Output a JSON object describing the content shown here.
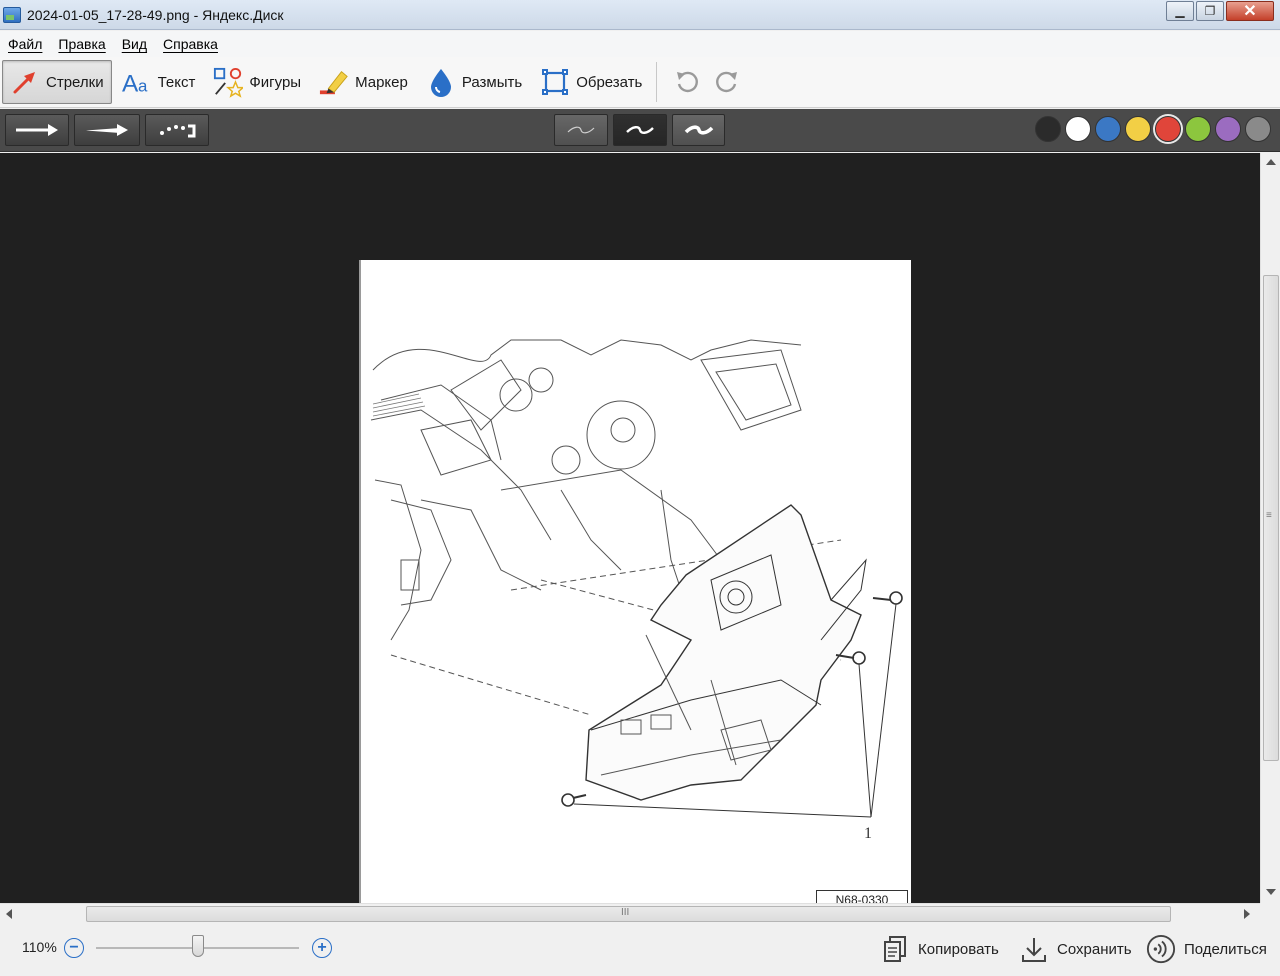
{
  "window": {
    "title": "2024-01-05_17-28-49.png - Яндекс.Диск",
    "minimize_glyph": "▁",
    "maximize_glyph": "❐",
    "close_glyph": "✕"
  },
  "menu": [
    {
      "label": "Файл"
    },
    {
      "label": "Правка"
    },
    {
      "label": "Вид"
    },
    {
      "label": "Справка"
    }
  ],
  "toolbar": {
    "tools": [
      {
        "label": "Стрелки",
        "icon": "arrow-tool-icon",
        "active": true
      },
      {
        "label": "Текст",
        "icon": "text-tool-icon",
        "active": false
      },
      {
        "label": "Фигуры",
        "icon": "shapes-tool-icon",
        "active": false
      },
      {
        "label": "Маркер",
        "icon": "marker-tool-icon",
        "active": false
      },
      {
        "label": "Размыть",
        "icon": "blur-tool-icon",
        "active": false
      },
      {
        "label": "Обрезать",
        "icon": "crop-tool-icon",
        "active": false
      }
    ],
    "undo_icon": "undo-icon",
    "redo_icon": "redo-icon"
  },
  "options": {
    "arrow_styles": [
      "straight-arrow",
      "thin-arrow",
      "dotted-arrow"
    ],
    "thickness": [
      "thin",
      "medium",
      "thick"
    ],
    "selected_thickness": "medium",
    "colors": [
      {
        "name": "black",
        "hex": "#2b2b2b"
      },
      {
        "name": "white",
        "hex": "#ffffff"
      },
      {
        "name": "blue",
        "hex": "#3b78c4"
      },
      {
        "name": "yellow",
        "hex": "#f2cf45"
      },
      {
        "name": "red",
        "hex": "#e0453a"
      },
      {
        "name": "green",
        "hex": "#8cc63e"
      },
      {
        "name": "purple",
        "hex": "#9b6cc0"
      },
      {
        "name": "gray",
        "hex": "#8a8a8a"
      }
    ],
    "selected_color": "red"
  },
  "document": {
    "callout_label": "1",
    "figure_code": "N68-0330"
  },
  "status": {
    "zoom": "110%",
    "zoom_out_glyph": "−",
    "zoom_in_glyph": "+",
    "actions": [
      {
        "label": "Копировать",
        "icon": "copy-icon"
      },
      {
        "label": "Сохранить",
        "icon": "download-icon"
      },
      {
        "label": "Поделиться",
        "icon": "share-icon"
      }
    ]
  },
  "scroll": {
    "hthumb_grip": "III",
    "vthumb_grip": "≡"
  }
}
